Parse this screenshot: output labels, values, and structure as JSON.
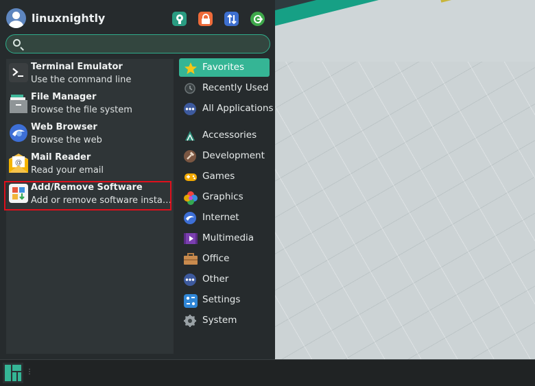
{
  "user": {
    "name": "linuxnightly"
  },
  "header_icons": [
    {
      "name": "settings-manager-icon",
      "color": "#2a9c82",
      "glyph": "⚙"
    },
    {
      "name": "lock-screen-icon",
      "color": "#e96b3c",
      "glyph": "🔒"
    },
    {
      "name": "switch-user-icon",
      "color": "#3d6fcf",
      "glyph": "⇅"
    },
    {
      "name": "logout-icon",
      "color": "#3ea84a",
      "glyph": "⏻"
    }
  ],
  "search": {
    "value": "",
    "placeholder": ""
  },
  "favorites": [
    {
      "title": "Terminal Emulator",
      "desc": "Use the command line",
      "icon": "terminal-icon"
    },
    {
      "title": "File Manager",
      "desc": "Browse the file system",
      "icon": "file-manager-icon"
    },
    {
      "title": "Web Browser",
      "desc": "Browse the web",
      "icon": "web-browser-icon"
    },
    {
      "title": "Mail Reader",
      "desc": "Read your email",
      "icon": "mail-icon"
    },
    {
      "title": "Add/Remove Software",
      "desc": "Add or remove software installed on the system",
      "icon": "software-icon"
    }
  ],
  "categories": [
    {
      "label": "Favorites",
      "icon": "star-icon",
      "active": true
    },
    {
      "label": "Recently Used",
      "icon": "clock-icon"
    },
    {
      "label": "All Applications",
      "icon": "all-apps-icon"
    },
    {
      "label": "Accessories",
      "icon": "accessories-icon"
    },
    {
      "label": "Development",
      "icon": "development-icon"
    },
    {
      "label": "Games",
      "icon": "games-icon"
    },
    {
      "label": "Graphics",
      "icon": "graphics-icon"
    },
    {
      "label": "Internet",
      "icon": "internet-icon"
    },
    {
      "label": "Multimedia",
      "icon": "multimedia-icon"
    },
    {
      "label": "Office",
      "icon": "office-icon"
    },
    {
      "label": "Other",
      "icon": "other-icon"
    },
    {
      "label": "Settings",
      "icon": "settings-icon"
    },
    {
      "label": "System",
      "icon": "system-icon"
    }
  ],
  "colors": {
    "accent": "#35b595",
    "highlight": "#e0101c"
  }
}
